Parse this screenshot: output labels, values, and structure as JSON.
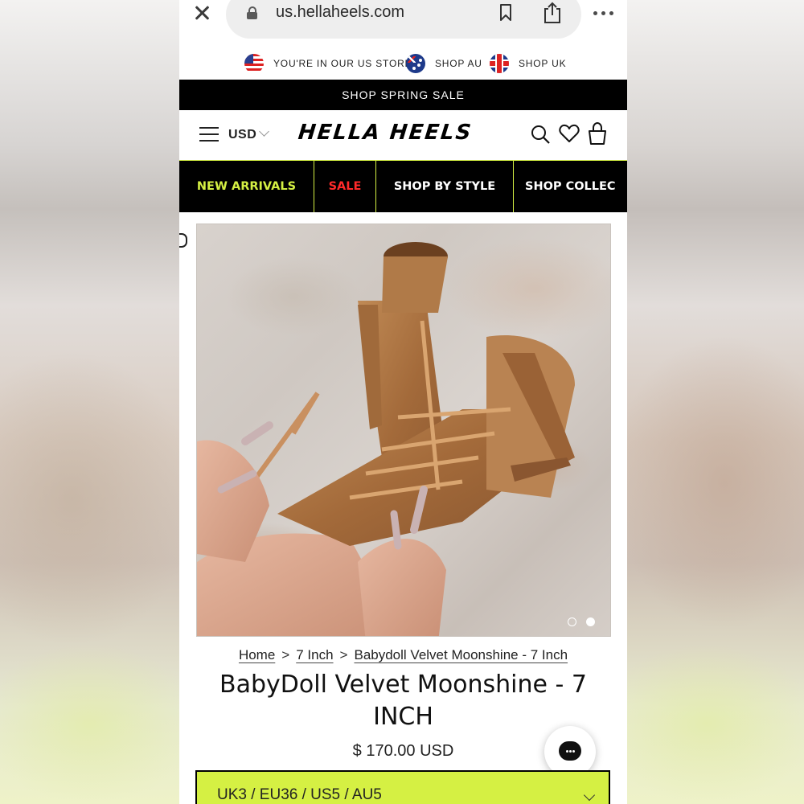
{
  "browser": {
    "url": "us.hellaheels.com"
  },
  "store_selector": {
    "current": "YOU'RE IN OUR US STORE",
    "au": "SHOP AU",
    "uk": "SHOP UK"
  },
  "promo": {
    "text": "SHOP SPRING SALE"
  },
  "header": {
    "currency": "USD",
    "logo": "HELLA HEELS"
  },
  "nav": {
    "items": [
      {
        "label": "NEW ARRIVALS",
        "color": "#d5f043"
      },
      {
        "label": "SALE",
        "color": "#ff2a2a"
      },
      {
        "label": "SHOP BY STYLE",
        "color": "#ffffff"
      },
      {
        "label": "SHOP COLLEC",
        "color": "#ffffff"
      }
    ]
  },
  "carousel": {
    "slides": 2,
    "active_slide": 2
  },
  "breadcrumb": {
    "items": [
      "Home",
      "7 Inch",
      "Babydoll Velvet Moonshine - 7 Inch"
    ],
    "separator": ">"
  },
  "product": {
    "title": "BabyDoll Velvet Moonshine - 7 INCH",
    "price": "$ 170.00 USD"
  },
  "size_select": {
    "value": "UK3 / EU36 / US5 / AU5"
  },
  "colors": {
    "accent": "#d5f043",
    "sale": "#ff2a2a",
    "nav_bg": "#000000"
  },
  "icons": [
    "close-icon",
    "lock-icon",
    "bookmark-icon",
    "share-icon",
    "more-icon",
    "menu-icon",
    "chevron-down-icon",
    "search-icon",
    "heart-icon",
    "bag-icon",
    "chat-icon"
  ]
}
